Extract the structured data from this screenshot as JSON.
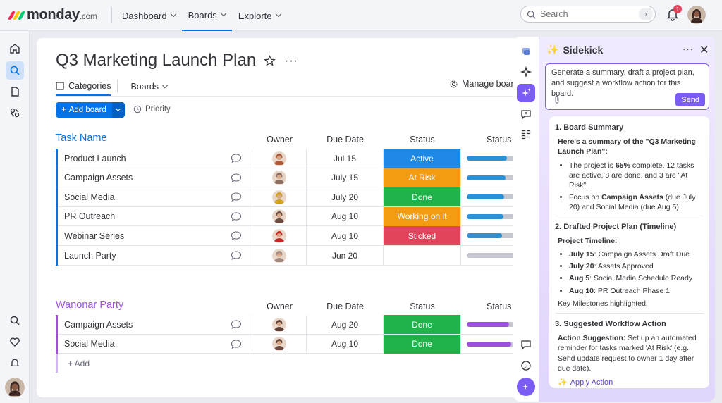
{
  "topbar": {
    "logo_text": "monday",
    "logo_suffix": ".com",
    "nav": [
      {
        "label": "Dashboard"
      },
      {
        "label": "Boards"
      },
      {
        "label": "Explorte"
      }
    ],
    "search_placeholder": "Search",
    "notification_count": "1"
  },
  "board": {
    "title": "Q3 Marketing Launch Plan",
    "tabs": [
      {
        "label": "Categories"
      },
      {
        "label": "Boards"
      }
    ],
    "manage_label": "Manage board",
    "add_board_label": "Add board",
    "priority_label": "Priority"
  },
  "columns": {
    "owner": "Owner",
    "due": "Due Date",
    "status": "Status",
    "status2": "Status"
  },
  "groups": [
    {
      "title": "Task Name",
      "color": "#0073ea",
      "rows": [
        {
          "name": "Product Launch",
          "due": "Jul 15",
          "status": "Active",
          "status_color": "#1e88e5",
          "progress": 0.82,
          "bar_color": "#2a91d6",
          "avatar": "#b05a3c"
        },
        {
          "name": "Campaign Assets",
          "due": "July 15",
          "status": "At Risk",
          "status_color": "#f39c12",
          "progress": 0.78,
          "bar_color": "#2a91d6",
          "avatar": "#8d6e63"
        },
        {
          "name": "Social Media",
          "due": "July 20",
          "status": "Done",
          "status_color": "#21b24b",
          "progress": 0.76,
          "bar_color": "#2a91d6",
          "avatar": "#d4a017"
        },
        {
          "name": "PR Outreach",
          "due": "Aug 10",
          "status": "Working on it",
          "status_color": "#f39c12",
          "progress": 0.74,
          "bar_color": "#2a91d6",
          "avatar": "#6d4c41"
        },
        {
          "name": "Webinar Series",
          "due": "Aug 10",
          "status": "Sticked",
          "status_color": "#e2445c",
          "progress": 0.72,
          "bar_color": "#2a91d6",
          "avatar": "#c62828"
        },
        {
          "name": "Launch Party",
          "due": "Jun 20",
          "status": "",
          "status_color": "#ffffff",
          "progress": 0.0,
          "bar_color": "#2a91d6",
          "avatar": "#a1887f"
        }
      ]
    },
    {
      "title": "Wanonar Party",
      "color": "#9d50dd",
      "rows": [
        {
          "name": "Campaign Assets",
          "due": "Aug 20",
          "status": "Done",
          "status_color": "#21b24b",
          "progress": 0.85,
          "bar_color": "#9d50dd",
          "avatar": "#5d4037"
        },
        {
          "name": "Social Media",
          "due": "Aug 10",
          "status": "Done",
          "status_color": "#21b24b",
          "progress": 0.9,
          "bar_color": "#9d50dd",
          "avatar": "#6d4c41"
        }
      ],
      "add_label": "+ Add"
    }
  ],
  "sidekick": {
    "title": "Sidekick",
    "prompt": "Generate a summary, draft a project plan, and suggest a workflow action for this board.",
    "send_label": "Send",
    "s1_title": "1. Board Summary",
    "s1_sub": "Here's a summary of the \"Q3 Marketing Launch Plan\":",
    "s1_b1_a": "The project is ",
    "s1_b1_pct": "65%",
    "s1_b1_b": " complete. 12 tasks are active, 8 are done, and 3 are \"At Risk\".",
    "s1_b2_a": "Focus on ",
    "s1_b2_bold": "Campaign Assets",
    "s1_b2_b": " (due July 20) and Social Media (due Aug 5).",
    "s2_title": "2. Drafted Project Plan (Timeline)",
    "s2_sub": "Project Timeline:",
    "timeline": [
      {
        "date": "July 15",
        "text": ": Campaign Assets Draft Due"
      },
      {
        "date": "July 20",
        "text": ": Assets Approved"
      },
      {
        "date": "Aug 5",
        "text": ": Social Media Schedule Ready"
      },
      {
        "date": "Aug 10",
        "text": ": PR Outreach Phase 1."
      }
    ],
    "s2_note": "Key Milestones highlighted.",
    "s3_title": "3. Suggested Workflow Action",
    "s3_label": "Action Suggestion:",
    "s3_text": " Set up an automated reminder for tasks marked 'At Risk' (e.g., Send update request to owner 1 day after due date).",
    "apply_label": "Apply Action"
  }
}
